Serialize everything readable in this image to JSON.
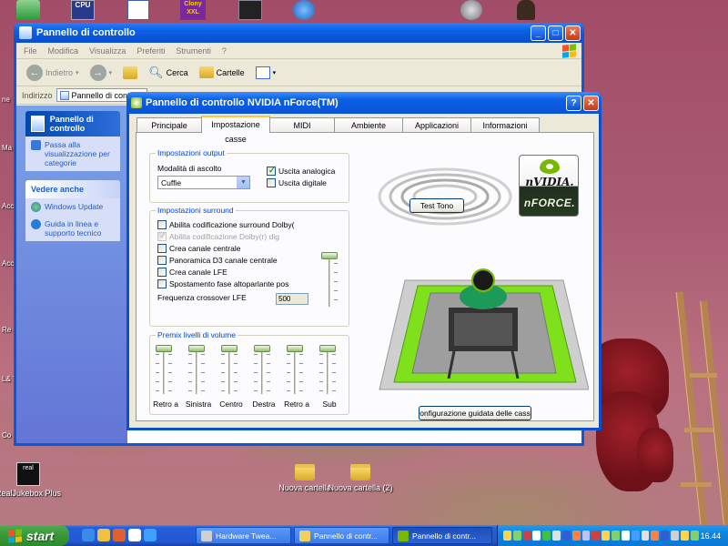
{
  "desktop": {
    "icons": [
      {
        "label": "RealJukebox Plus",
        "icon": "realjukebox-icon"
      },
      {
        "label": "Nuova cartella",
        "icon": "folder-icon"
      },
      {
        "label": "Nuova cartella (2)",
        "icon": "folder-icon"
      }
    ],
    "top_icons": [
      {
        "label": "CPU",
        "icon": "cpu-z-icon"
      },
      {
        "label": "Clony XXL",
        "icon": "clony-icon"
      }
    ],
    "edge_labels": [
      "ne",
      "Ma",
      "Acc Co",
      "Acc",
      "Re",
      "L& Tra",
      "Co Sr"
    ]
  },
  "explorer": {
    "title": "Pannello di controllo",
    "menu": [
      "File",
      "Modifica",
      "Visualizza",
      "Preferiti",
      "Strumenti",
      "?"
    ],
    "toolbar": {
      "back": "Indietro",
      "search": "Cerca",
      "folders": "Cartelle"
    },
    "address_label": "Indirizzo",
    "address_value": "Pannello di contr",
    "taskpane": {
      "panel_title": "Pannello di controllo",
      "switch_link": "Passa alla visualizzazione per categorie",
      "see_also_title": "Vedere anche",
      "see_also_items": [
        "Windows Update",
        "Guida in linea e supporto tecnico"
      ]
    }
  },
  "nvidia": {
    "title": "Pannello di controllo NVIDIA nForce(TM)",
    "tabs": [
      "Principale",
      "Impostazione casse",
      "MIDI",
      "Ambiente",
      "Applicazioni",
      "Informazioni"
    ],
    "active_tab": "Impostazione casse",
    "output_group": {
      "title": "Impostazioni output",
      "listening_mode_label": "Modalità di ascolto",
      "listening_mode_value": "Cuffie",
      "analog_output": {
        "label": "Uscita analogica",
        "checked": true
      },
      "digital_output": {
        "label": "Uscita digitale",
        "checked": false
      }
    },
    "test_tone_button": "Test Tono",
    "logo": {
      "brand": "nVIDIA.",
      "product": "nFORCE."
    },
    "surround_group": {
      "title": "Impostazioni surround",
      "options": [
        {
          "label": "Abilita codificazione surround Dolby(",
          "checked": false,
          "disabled": false
        },
        {
          "label": "Abilita codificazione Dolby(r) dig",
          "checked": true,
          "disabled": true
        },
        {
          "label": "Crea canale centrale",
          "checked": false,
          "disabled": false
        },
        {
          "label": "Panoramica D3 canale centrale",
          "checked": false,
          "disabled": false
        },
        {
          "label": "Crea canale LFE",
          "checked": false,
          "disabled": false
        },
        {
          "label": "Spostamento fase altoparlante pos",
          "checked": false,
          "disabled": false
        }
      ],
      "crossover_label": "Frequenza crossover LFE",
      "crossover_value": "500"
    },
    "premix_group": {
      "title": "Premix livelli di volume",
      "channels": [
        "Retro a",
        "Sinistra",
        "Centro",
        "Destra",
        "Retro a",
        "Sub"
      ]
    },
    "wizard_button": "onfigurazione guidata delle cass"
  },
  "taskbar": {
    "start_label": "start",
    "tasks": [
      {
        "label": "Hardware Twea...",
        "active": false
      },
      {
        "label": "Pannello di contr...",
        "active": false
      },
      {
        "label": "Pannello di contr...",
        "active": true
      }
    ],
    "clock": "16.44"
  }
}
